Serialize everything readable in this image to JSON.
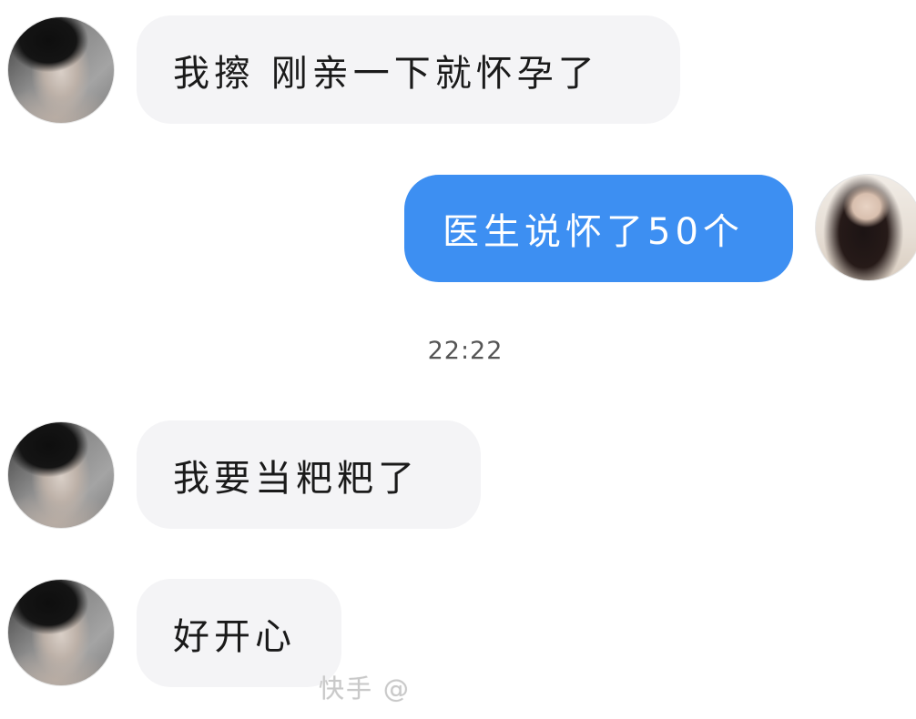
{
  "conversation": {
    "messages": [
      {
        "sender": "other",
        "text": "我擦 刚亲一下就怀孕了"
      },
      {
        "sender": "self",
        "text": "医生说怀了50个"
      },
      {
        "sender": "other",
        "text": "我要当粑粑了"
      },
      {
        "sender": "other",
        "text": "好开心"
      }
    ],
    "timestamp": "22:22"
  },
  "watermark": {
    "text": "快手 @"
  },
  "colors": {
    "outgoing_bubble": "#3d8ff2",
    "incoming_bubble": "#f4f4f6",
    "page_background": "#ffffff"
  },
  "icons": {
    "left_avatar": "avatar-portrait-male",
    "right_avatar": "avatar-portrait-female"
  }
}
